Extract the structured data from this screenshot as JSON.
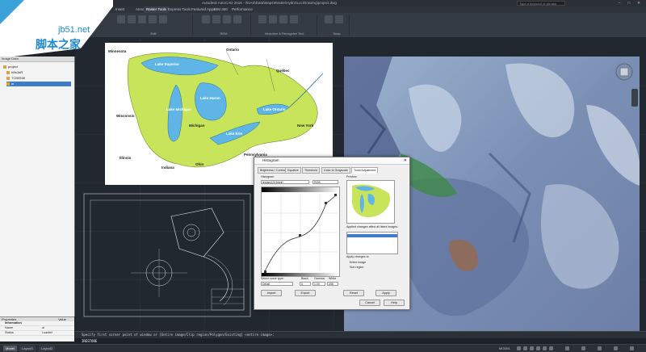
{
  "window": {
    "title": "Autodesk AutoCAD 2016 - \\\\NAS\\Data\\Maps\\Raster\\Hydro\\Loc\\Drawing\\project.dwg",
    "search_placeholder": "Type a keyword or phrase"
  },
  "ribbon": {
    "tabs": [
      "Insert",
      "Annotate",
      "Parametric",
      "View",
      "Manage",
      "Output",
      "Raster Tools",
      "Edit",
      "Raster Tools",
      "Express Tools",
      "Featured Apps",
      "BIM 360",
      "Performance"
    ],
    "active_tab": "Raster Tools",
    "panels": [
      "Edit",
      "REM",
      "Vectorize & Recognize Text",
      "Snap"
    ]
  },
  "logo": {
    "site": "jb51.net",
    "text": "脚本之家"
  },
  "left_panel": {
    "title": "Image Data",
    "tree": [
      "project",
      "hills3dR",
      "TCB9538",
      "ai"
    ],
    "properties": {
      "header": [
        "Properties",
        "Value"
      ],
      "group": "Information",
      "rows": [
        {
          "name": "Name",
          "value": "ai"
        },
        {
          "name": "Status",
          "value": "Loaded"
        }
      ]
    }
  },
  "map": {
    "labels": [
      "Ontario",
      "Québec",
      "Lake Superior",
      "Lake Michigan",
      "Lake Huron",
      "Lake Ontario",
      "Lake Erie",
      "Wisconsin",
      "Michigan",
      "Illinois",
      "Indiana",
      "Ohio",
      "Pennsylvania",
      "New York",
      "Minnesota"
    ]
  },
  "dialog": {
    "title": "Histogram",
    "tabs": [
      "Brightness / Contrast",
      "Equalize",
      "Threshold",
      "Color to Grayscale",
      "Tonal Adjustment"
    ],
    "active_tab": "Tonal Adjustment",
    "histogram_label": "Histogram",
    "image_name": "lindam229 bisn0",
    "channel": "RGB",
    "preview_label": "Preview",
    "applied_label": "Applied changes affect all listed images:",
    "apply_to_label": "Apply changes to",
    "apply_options": [
      "Entire image",
      "Sub region"
    ],
    "curve_type_label": "Select curve type:",
    "curve_type": "Detail",
    "black_label": "Black",
    "gamma_label": "Gamma",
    "white_label": "White",
    "black": "0",
    "gamma": "1.00",
    "white": "255",
    "buttons": {
      "import": "Import",
      "export": "Export",
      "reset": "Reset",
      "apply": "Apply",
      "cancel": "Cancel",
      "help": "Help"
    }
  },
  "command": {
    "history": "Specify first corner point of window or [Entire image/Clip region/Polygon/Existing] <entire image>:",
    "prompt": "IRESTORE"
  },
  "status": {
    "tabs": [
      "Model",
      "Layout1",
      "Layout2"
    ],
    "active": "Model",
    "model_label": "MODEL"
  },
  "colors": {
    "map_land": "#c7e45a",
    "map_water": "#5fb6e6",
    "satellite_base": "#8fa7c4"
  }
}
